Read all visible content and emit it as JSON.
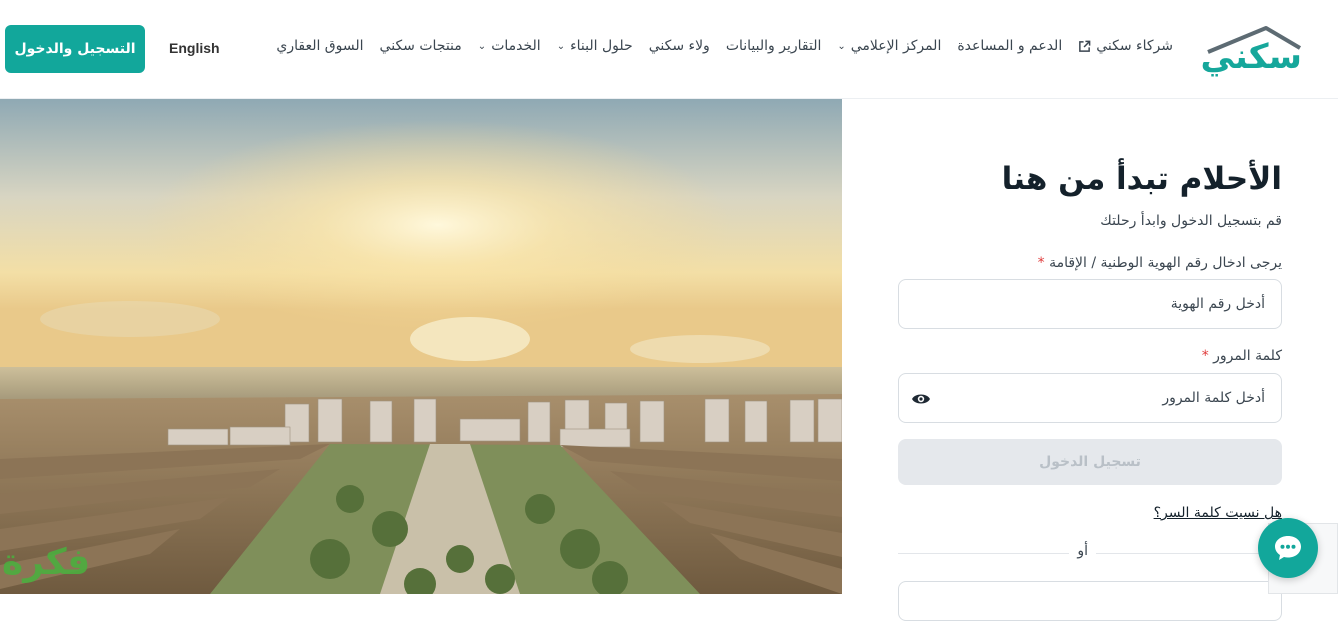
{
  "header": {
    "logo_text": "سكني",
    "nav": [
      {
        "label": "السوق العقاري",
        "dropdown": false
      },
      {
        "label": "منتجات سكني",
        "dropdown": false
      },
      {
        "label": "الخدمات",
        "dropdown": true
      },
      {
        "label": "حلول البناء",
        "dropdown": true
      },
      {
        "label": "ولاء سكني",
        "dropdown": false
      },
      {
        "label": "التقارير والبيانات",
        "dropdown": false
      },
      {
        "label": "المركز الإعلامي",
        "dropdown": true
      },
      {
        "label": "الدعم و المساعدة",
        "dropdown": false
      },
      {
        "label": "شركاء سكني",
        "dropdown": false,
        "external": true
      }
    ],
    "language_label": "English",
    "signin_label": "التسجيل والدخول"
  },
  "form": {
    "title": "الأحلام تبدأ من هنا",
    "subtitle": "قم بتسجيل الدخول وابدأ رحلتك",
    "id_label": "يرجى ادخال رقم الهوية الوطنية / الإقامة",
    "id_placeholder": "أدخل رقم الهوية",
    "password_label": "كلمة المرور",
    "password_placeholder": "أدخل كلمة المرور",
    "required_mark": "*",
    "login_label": "تسجيل الدخول",
    "forgot_label": "هل نسيت كلمة السر؟",
    "or_label": "أو"
  },
  "watermark": {
    "text": "فكرة"
  },
  "colors": {
    "accent": "#12a79b",
    "required": "#e03b3b",
    "disabled_bg": "#e5e8ec"
  }
}
